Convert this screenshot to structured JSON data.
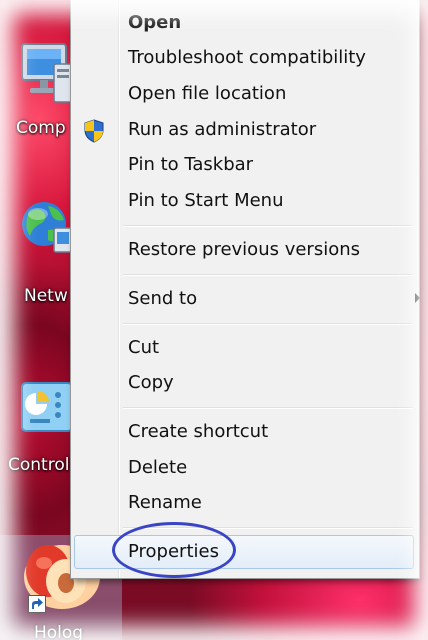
{
  "desktop": {
    "icons": [
      {
        "label": "Comp",
        "icon": "computer-icon"
      },
      {
        "label": "Netw",
        "icon": "network-icon"
      },
      {
        "label": "Control",
        "icon": "control-panel-icon"
      },
      {
        "label": "Holog",
        "icon": "peach-shortcut-icon"
      }
    ]
  },
  "menu": {
    "items": [
      {
        "label": "Open",
        "bold": true
      },
      {
        "label": "Troubleshoot compatibility"
      },
      {
        "label": "Open file location"
      },
      {
        "label": "Run as administrator",
        "icon": "uac-shield-icon"
      },
      {
        "label": "Pin to Taskbar"
      },
      {
        "label": "Pin to Start Menu"
      },
      {
        "label": "Restore previous versions"
      },
      {
        "label": "Send to",
        "submenu": true
      },
      {
        "label": "Cut"
      },
      {
        "label": "Copy"
      },
      {
        "label": "Create shortcut"
      },
      {
        "label": "Delete"
      },
      {
        "label": "Rename"
      },
      {
        "label": "Properties",
        "highlighted": true
      }
    ]
  },
  "colors": {
    "wallpaper": "#c01236",
    "annotation": "#3a45c6",
    "hover_border": "#a8c8e8"
  }
}
